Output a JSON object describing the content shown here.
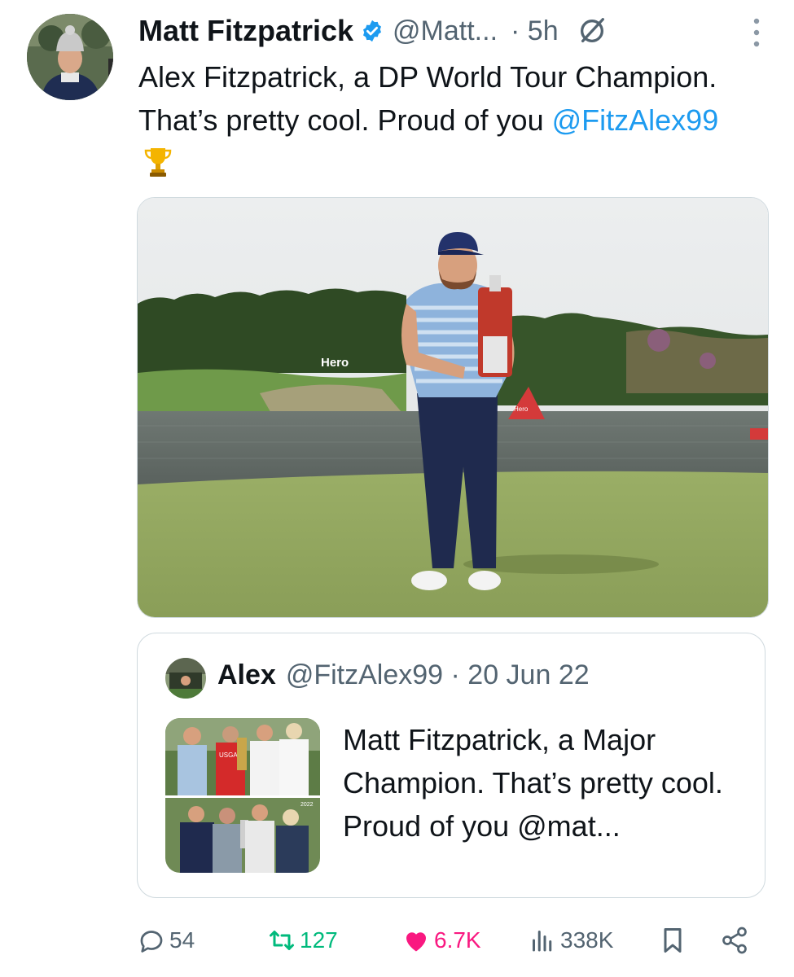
{
  "tweet": {
    "author_name": "Matt Fitzpatrick",
    "author_handle": "@Matt...",
    "time": "· 5h",
    "text_before": "Alex Fitzpatrick, a DP World Tour Champion. That’s pretty cool. Proud of you ",
    "mention": "@FitzAlex99",
    "emoji": "trophy-emoji",
    "image_sponsor_text": "Hero",
    "image_flag_text": "Hero"
  },
  "quote": {
    "author_name": "Alex",
    "author_handle_time": "@FitzAlex99 · 20 Jun 22",
    "text": "Matt Fitzpatrick, a Major Champion. That’s pretty cool. Proud of you @mat...",
    "thumb_badge": "USGA",
    "thumb_year": "2022"
  },
  "actions": {
    "replies": "54",
    "reposts": "127",
    "likes": "6.7K",
    "views": "338K"
  },
  "colors": {
    "link": "#1d9bf0",
    "secondary_text": "#536471",
    "repost_active": "#00ba7c",
    "like_active": "#f91880",
    "verified": "#1d9bf0"
  }
}
